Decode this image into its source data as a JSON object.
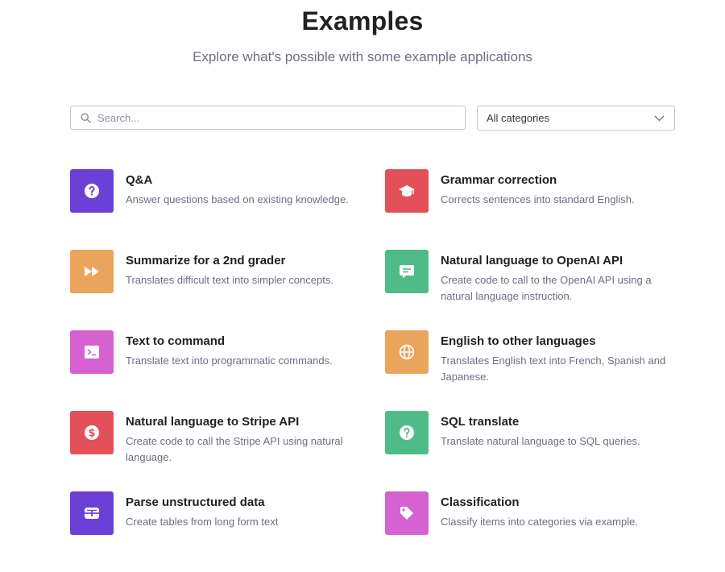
{
  "header": {
    "title": "Examples",
    "subtitle": "Explore what's possible with some example applications"
  },
  "search": {
    "placeholder": "Search...",
    "value": ""
  },
  "category_select": {
    "selected": "All categories"
  },
  "examples": [
    {
      "name": "Q&A",
      "description": "Answer questions based on existing knowledge.",
      "icon": "question-icon",
      "color": "#6b40d6"
    },
    {
      "name": "Grammar correction",
      "description": "Corrects sentences into standard English.",
      "icon": "graduation-cap-icon",
      "color": "#e4505a"
    },
    {
      "name": "Summarize for a 2nd grader",
      "description": "Translates difficult text into simpler concepts.",
      "icon": "fast-forward-icon",
      "color": "#eaa45c"
    },
    {
      "name": "Natural language to OpenAI API",
      "description": "Create code to call to the OpenAI API using a natural language instruction.",
      "icon": "chat-icon",
      "color": "#4fbb87"
    },
    {
      "name": "Text to command",
      "description": "Translate text into programmatic commands.",
      "icon": "terminal-icon",
      "color": "#d661d1"
    },
    {
      "name": "English to other languages",
      "description": "Translates English text into French, Spanish and Japanese.",
      "icon": "globe-icon",
      "color": "#eaa45c"
    },
    {
      "name": "Natural language to Stripe API",
      "description": "Create code to call the Stripe API using natural language.",
      "icon": "dollar-icon",
      "color": "#e4505a"
    },
    {
      "name": "SQL translate",
      "description": "Translate natural language to SQL queries.",
      "icon": "question-icon",
      "color": "#4fbb87"
    },
    {
      "name": "Parse unstructured data",
      "description": "Create tables from long form text",
      "icon": "table-icon",
      "color": "#6b40d6"
    },
    {
      "name": "Classification",
      "description": "Classify items into categories via example.",
      "icon": "tag-icon",
      "color": "#d661d1"
    }
  ]
}
